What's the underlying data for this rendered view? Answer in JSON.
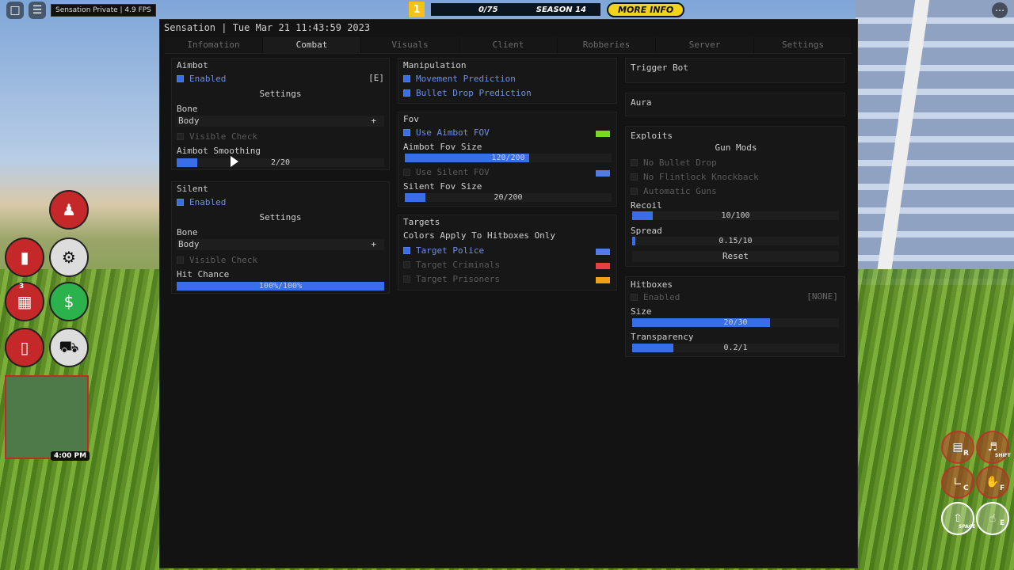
{
  "hud": {
    "fps_label": "Sensation Private | 4.9 FPS",
    "level_badge": "1",
    "progress": "0/75",
    "season": "SEASON 14",
    "more_info": "MORE INFO",
    "menu_icon": "ellipsis-icon",
    "minimap_time": "4:00 PM",
    "icon_badge": "3",
    "key_r": "R",
    "key_c": "C",
    "key_f": "F",
    "key_e": "E",
    "key_space": "SPACE",
    "key_shift": "SHIFT"
  },
  "window": {
    "title": "Sensation | Tue Mar 21 11:43:59 2023",
    "accent": "#3a6ee8",
    "tabs": [
      {
        "label": "Infomation",
        "active": false
      },
      {
        "label": "Combat",
        "active": true
      },
      {
        "label": "Visuals",
        "active": false
      },
      {
        "label": "Client",
        "active": false
      },
      {
        "label": "Robberies",
        "active": false
      },
      {
        "label": "Server",
        "active": false
      },
      {
        "label": "Settings",
        "active": false
      }
    ]
  },
  "aimbot": {
    "title": "Aimbot",
    "enabled_label": "Enabled",
    "enabled": true,
    "keybind": "[E]",
    "settings_label": "Settings",
    "bone_label": "Bone",
    "bone_value": "Body",
    "visible_check": "Visible Check",
    "smoothing_label": "Aimbot Smoothing",
    "smoothing_value": "2/20",
    "smoothing_fraction": 0.1
  },
  "silent": {
    "title": "Silent",
    "enabled_label": "Enabled",
    "enabled": true,
    "settings_label": "Settings",
    "bone_label": "Bone",
    "bone_value": "Body",
    "visible_check": "Visible Check",
    "hit_chance_label": "Hit Chance",
    "hit_chance_value": "100%/100%",
    "hit_chance_fraction": 1.0
  },
  "manipulation": {
    "title": "Manipulation",
    "movement_prediction": "Movement Prediction",
    "bullet_drop_prediction": "Bullet Drop Prediction"
  },
  "fov": {
    "title": "Fov",
    "use_aimbot_fov": "Use Aimbot FOV",
    "aimbot_fov_color": "#7fd61a",
    "aimbot_fov_size_label": "Aimbot Fov Size",
    "aimbot_fov_size_value": "120/200",
    "aimbot_fov_fraction": 0.6,
    "use_silent_fov": "Use Silent FOV",
    "silent_fov_color": "#4f7de8",
    "silent_fov_size_label": "Silent Fov Size",
    "silent_fov_size_value": "20/200",
    "silent_fov_fraction": 0.1
  },
  "targets": {
    "title": "Targets",
    "note": "Colors Apply To Hitboxes Only",
    "police": "Target Police",
    "police_color": "#4f7de8",
    "criminals": "Target Criminals",
    "criminals_color": "#e84040",
    "prisoners": "Target Prisoners",
    "prisoners_color": "#f0a010"
  },
  "trigger_bot": {
    "title": "Trigger Bot"
  },
  "aura": {
    "title": "Aura"
  },
  "exploits": {
    "title": "Exploits",
    "gun_mods_label": "Gun Mods",
    "no_bullet_drop": "No Bullet Drop",
    "no_flintlock_knockback": "No Flintlock Knockback",
    "automatic_guns": "Automatic Guns",
    "recoil_label": "Recoil",
    "recoil_value": "10/100",
    "recoil_fraction": 0.1,
    "spread_label": "Spread",
    "spread_value": "0.15/10",
    "spread_fraction": 0.015,
    "reset_label": "Reset"
  },
  "hitboxes": {
    "title": "Hitboxes",
    "enabled_label": "Enabled",
    "keybind": "[NONE]",
    "size_label": "Size",
    "size_value": "20/30",
    "size_fraction": 0.667,
    "transparency_label": "Transparency",
    "transparency_value": "0.2/1",
    "transparency_fraction": 0.2
  }
}
